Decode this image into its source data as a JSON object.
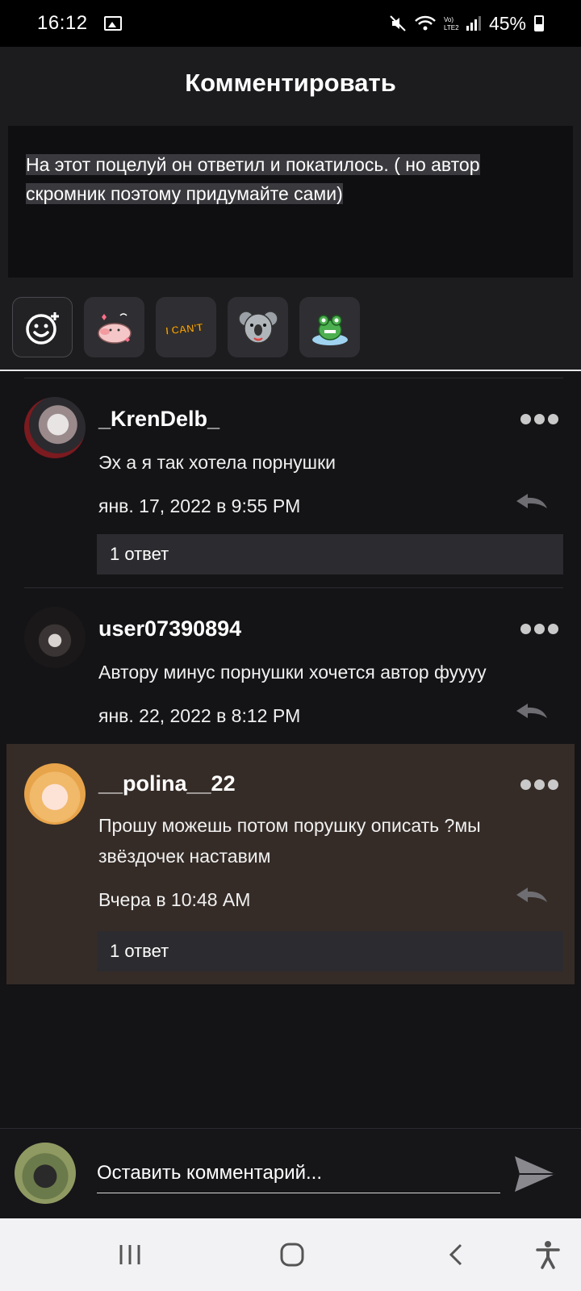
{
  "status_bar": {
    "time": "16:12",
    "battery": "45%"
  },
  "header": {
    "title": "Комментировать"
  },
  "story": {
    "text": "На этот поцелуй он ответил и покатилось. ( но автор скромник поэтому придумайте сами)"
  },
  "stickers": [
    {
      "icon": "sticker-pig-icon"
    },
    {
      "icon": "sticker-i-cant-icon",
      "text": "I CAN'T"
    },
    {
      "icon": "sticker-koala-icon"
    },
    {
      "icon": "sticker-frog-icon"
    }
  ],
  "comments": [
    {
      "username": "_KrenDelb_",
      "text": "Эх а я так хотела порнушки",
      "date": "янв. 17, 2022 в 9:55 PM",
      "replies": "1 ответ"
    },
    {
      "username": "user07390894",
      "text": "Автору минус порнушки хочется автор  фуууу",
      "date": "янв. 22, 2022 в 8:12 PM"
    },
    {
      "username": "__polina__22",
      "text": "Прошу можешь потом порушку описать ?мы звёздочек наставим",
      "date": "Вчера в 10:48 AM",
      "replies": "1 ответ"
    }
  ],
  "composer": {
    "placeholder": "Оставить комментарий..."
  },
  "colors": {
    "background": "#141316",
    "highlight": "#352c27",
    "header": "#1c1b1e"
  }
}
